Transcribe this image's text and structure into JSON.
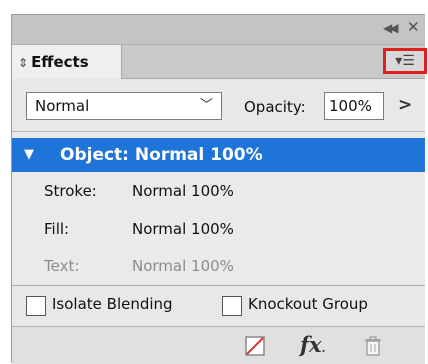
{
  "panel": {
    "tab_label": "Effects",
    "blend_mode_select": "Normal",
    "opacity_label": "Opacity:",
    "opacity_value": "100%",
    "layers": [
      {
        "name": "Object:",
        "value": "Normal 100%",
        "selected": true
      },
      {
        "name": "Stroke:",
        "value": "Normal 100%"
      },
      {
        "name": "Fill:",
        "value": "Normal 100%"
      },
      {
        "name": "Text:",
        "value": "Normal 100%",
        "disabled": true
      }
    ],
    "checkboxes": [
      {
        "label": "Isolate Blending",
        "checked": false
      },
      {
        "label": "Knockout Group",
        "checked": false
      }
    ],
    "bottom_icons": [
      "clear-effects-icon",
      "fx-icon",
      "trash-icon"
    ]
  },
  "colors": {
    "selection": "#1e74d8",
    "highlight": "#e0201c"
  }
}
